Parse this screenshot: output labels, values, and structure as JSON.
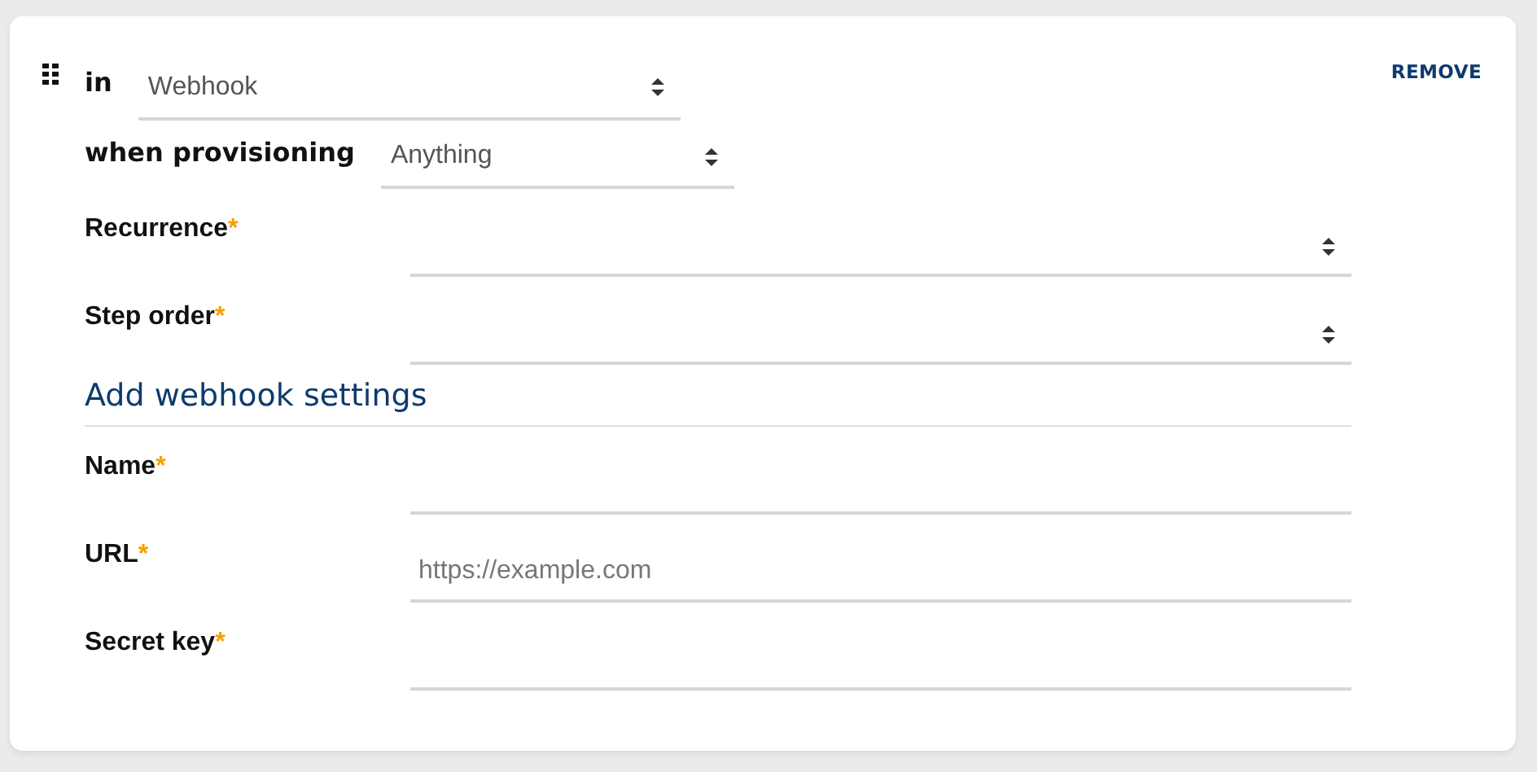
{
  "step": {
    "in_label": "in",
    "in_select": {
      "value": "Webhook"
    },
    "when_label": "when provisioning",
    "when_select": {
      "value": "Anything"
    },
    "remove_button": "REMOVE"
  },
  "fields": [
    {
      "kind": "select",
      "label": "Recurrence",
      "required_mark": "*"
    },
    {
      "kind": "select",
      "label": "Step order",
      "required_mark": "*"
    }
  ],
  "section": {
    "title": "Add webhook settings",
    "fields": [
      {
        "kind": "text",
        "label": "Name",
        "required_mark": "*"
      },
      {
        "kind": "text",
        "label": "URL",
        "required_mark": "*",
        "placeholder": "https://example.com"
      },
      {
        "kind": "text",
        "label": "Secret key",
        "required_mark": "*"
      }
    ]
  }
}
